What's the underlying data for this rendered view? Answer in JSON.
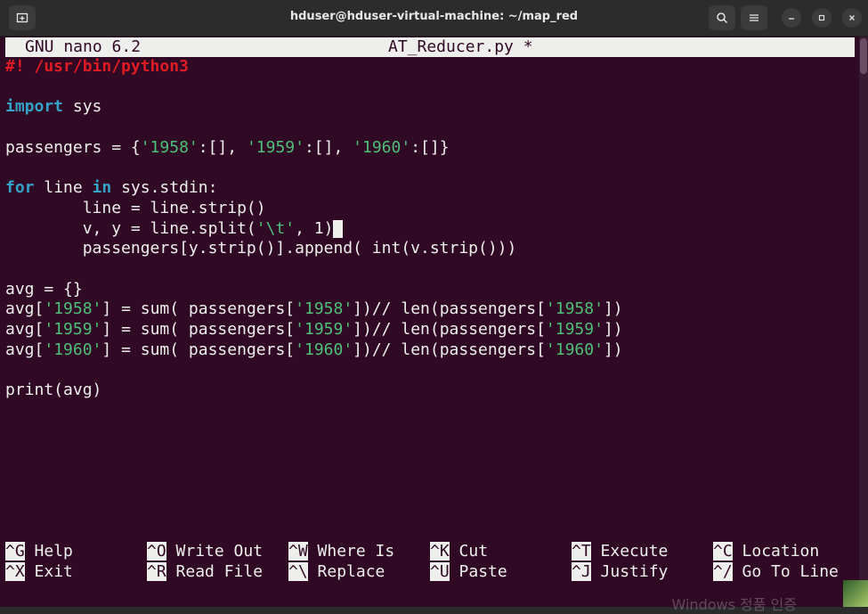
{
  "window": {
    "title": "hduser@hduser-virtual-machine: ~/map_red"
  },
  "nano": {
    "version": "GNU nano 6.2",
    "filename": "AT_Reducer.py *"
  },
  "code": [
    "#! /usr/bin/python3",
    "",
    "import sys",
    "",
    "passengers = {'1958':[], '1959':[], '1960':[]}",
    "",
    "for line in sys.stdin:",
    "        line = line.strip()",
    "        v, y = line.split('\\t', 1)",
    "        passengers[y.strip()].append( int(v.strip()))",
    "",
    "avg = {}",
    "avg['1958'] = sum( passengers['1958'])// len(passengers['1958'])",
    "avg['1959'] = sum( passengers['1959'])// len(passengers['1959'])",
    "avg['1960'] = sum( passengers['1960'])// len(passengers['1960'])",
    "",
    "print(avg)"
  ],
  "shortcuts": [
    {
      "key": "^G",
      "label": "Help"
    },
    {
      "key": "^O",
      "label": "Write Out"
    },
    {
      "key": "^W",
      "label": "Where Is"
    },
    {
      "key": "^K",
      "label": "Cut"
    },
    {
      "key": "^T",
      "label": "Execute"
    },
    {
      "key": "^C",
      "label": "Location"
    },
    {
      "key": "^X",
      "label": "Exit"
    },
    {
      "key": "^R",
      "label": "Read File"
    },
    {
      "key": "^\\",
      "label": "Replace"
    },
    {
      "key": "^U",
      "label": "Paste"
    },
    {
      "key": "^J",
      "label": "Justify"
    },
    {
      "key": "^/",
      "label": "Go To Line"
    }
  ],
  "watermark": "Windows 정품 인증",
  "icons": {
    "new_tab": "new-tab-icon",
    "search": "search-icon",
    "menu": "hamburger-menu-icon",
    "minimize": "minimize-icon",
    "maximize": "maximize-icon",
    "close": "close-icon"
  },
  "colors": {
    "terminal_bg": "#300a24",
    "keyword": "#35a2c8",
    "string": "#4fbf7a",
    "shebang": "#e01b24"
  }
}
